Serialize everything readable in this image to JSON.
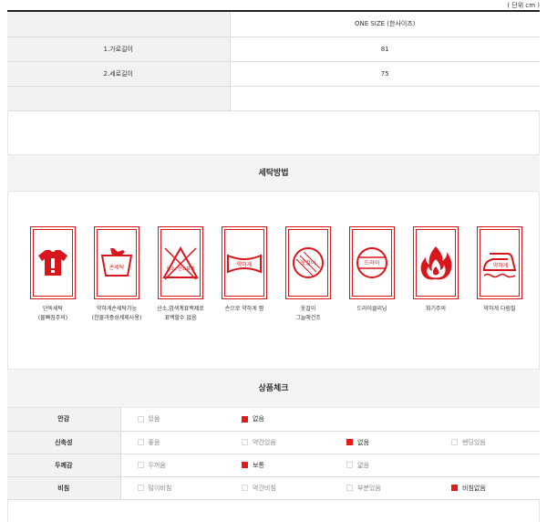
{
  "unit_label": "( 단위 cm )",
  "size_table": {
    "header": "ONE SIZE (한사이즈)",
    "rows": [
      {
        "label": "1.가로길이",
        "value": "81"
      },
      {
        "label": "2.세로길이",
        "value": "75"
      }
    ]
  },
  "wash_section": {
    "title": "세탁방법",
    "items": [
      {
        "icon": "shirt-warning-icon",
        "label": "단독세탁",
        "sub": "(물빠짐주의)"
      },
      {
        "icon": "hand-wash-tub-icon",
        "icon_text": "손세탁",
        "label": "약하게손세탁가능",
        "sub": "(찬물과중성세제사용)"
      },
      {
        "icon": "no-bleach-triangle-icon",
        "icon_text": "염소, 산소표백",
        "label": "산소,염색계표백제로",
        "sub": "표백할수 없음"
      },
      {
        "icon": "hand-wring-icon",
        "icon_text": "약하게",
        "label": "손으로 약하게 짬",
        "sub": ""
      },
      {
        "icon": "shade-dry-icon",
        "icon_text": "옷걸이",
        "label": "옷걸이",
        "sub": "그늘에건조"
      },
      {
        "icon": "dry-clean-icon",
        "icon_text": "드라이",
        "label": "드라이클리닝",
        "sub": ""
      },
      {
        "icon": "flammable-icon",
        "label": "화기주의",
        "sub": ""
      },
      {
        "icon": "iron-low-icon",
        "icon_text": "약하게",
        "label": "약하게 다림질",
        "sub": ""
      }
    ]
  },
  "check_section": {
    "title": "상품체크",
    "rows": [
      {
        "label": "안감",
        "options": [
          {
            "text": "있음",
            "checked": false
          },
          {
            "text": "없음",
            "checked": true
          }
        ]
      },
      {
        "label": "신축성",
        "options": [
          {
            "text": "좋음",
            "checked": false
          },
          {
            "text": "약간있음",
            "checked": false
          },
          {
            "text": "없음",
            "checked": true
          },
          {
            "text": "밴딩있음",
            "checked": false
          }
        ]
      },
      {
        "label": "두께감",
        "options": [
          {
            "text": "두꺼움",
            "checked": false
          },
          {
            "text": "보통",
            "checked": true
          },
          {
            "text": "얇음",
            "checked": false
          }
        ]
      },
      {
        "label": "비침",
        "options": [
          {
            "text": "많이비침",
            "checked": false
          },
          {
            "text": "약간비침",
            "checked": false
          },
          {
            "text": "부분있음",
            "checked": false
          },
          {
            "text": "비침없음",
            "checked": true
          }
        ]
      }
    ]
  },
  "colors": {
    "accent": "#d9161c",
    "checked": "#e21b1b"
  }
}
